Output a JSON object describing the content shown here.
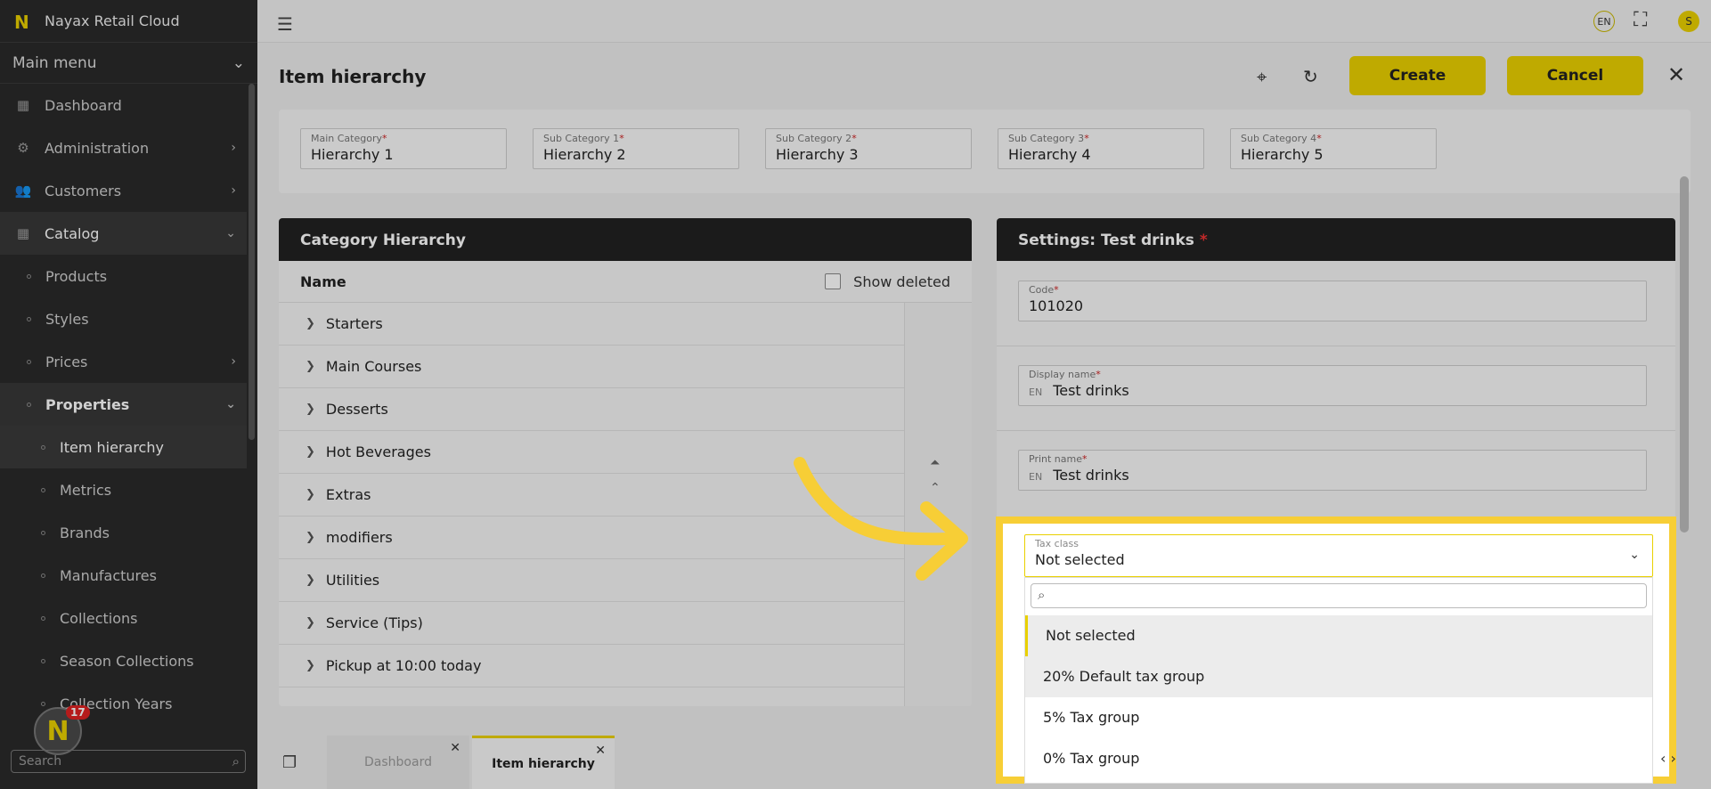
{
  "app": {
    "title": "Nayax Retail Cloud",
    "logo": "N"
  },
  "sidebar": {
    "menu_label": "Main menu",
    "items": [
      {
        "label": "Dashboard",
        "icon": "dashboard-icon",
        "glyph": "▦"
      },
      {
        "label": "Administration",
        "icon": "gear-icon",
        "glyph": "⚙",
        "chevron": "›"
      },
      {
        "label": "Customers",
        "icon": "users-icon",
        "glyph": "👥",
        "chevron": "›"
      },
      {
        "label": "Catalog",
        "icon": "grid-icon",
        "glyph": "▦",
        "chevron": "⌄"
      }
    ],
    "sub_items": [
      "Products",
      "Styles",
      "Prices",
      "Properties"
    ],
    "prices_chevron": "›",
    "properties_chevron": "⌄",
    "sub2_items": [
      "Item hierarchy",
      "Metrics",
      "Brands",
      "Manufactures",
      "Collections",
      "Season Collections",
      "Collection Years"
    ],
    "search_placeholder": "Search",
    "notification_count": "17"
  },
  "topbar": {
    "lang": "EN",
    "user_initial": "S"
  },
  "header": {
    "title": "Item hierarchy",
    "create_label": "Create",
    "cancel_label": "Cancel"
  },
  "hierarchy": [
    {
      "label": "Main Category",
      "value": "Hierarchy 1"
    },
    {
      "label": "Sub Category 1",
      "value": "Hierarchy 2"
    },
    {
      "label": "Sub Category 2",
      "value": "Hierarchy 3"
    },
    {
      "label": "Sub Category 3",
      "value": "Hierarchy 4"
    },
    {
      "label": "Sub Category 4",
      "value": "Hierarchy 5"
    }
  ],
  "category_panel": {
    "title": "Category Hierarchy",
    "name_header": "Name",
    "show_deleted": "Show deleted",
    "rows": [
      "Starters",
      "Main Courses",
      "Desserts",
      "Hot Beverages",
      "Extras",
      "modifiers",
      "Utilities",
      "Service (Tips)",
      "Pickup at 10:00 today"
    ]
  },
  "settings_panel": {
    "title": "Settings: Test drinks",
    "code_label": "Code",
    "code_value": "101020",
    "display_label": "Display name",
    "display_lang": "EN",
    "display_value": "Test drinks",
    "print_label": "Print name",
    "print_lang": "EN",
    "print_value": "Test drinks",
    "tax_label": "Tax class",
    "tax_value": "Not selected",
    "tax_options": [
      "Not selected",
      "20% Default tax group",
      "5% Tax group",
      "0% Tax group"
    ]
  },
  "bottom_tabs": [
    {
      "label": "Dashboard"
    },
    {
      "label": "Item hierarchy"
    }
  ],
  "colors": {
    "accent": "#e9d000",
    "highlight": "#f7ce36",
    "sidebar": "#2a2a2a"
  }
}
